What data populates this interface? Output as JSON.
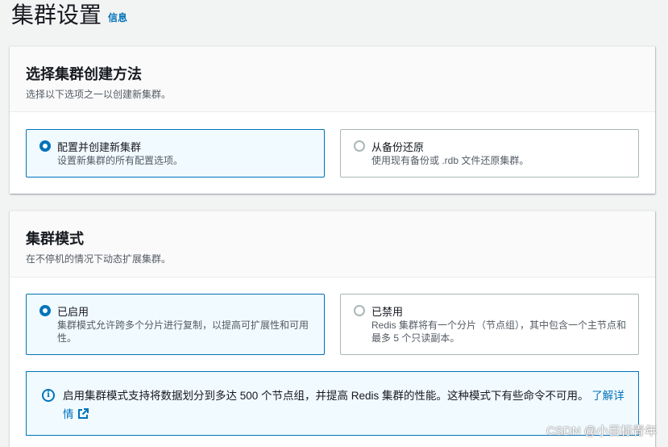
{
  "header": {
    "title": "集群设置",
    "info": "信息"
  },
  "creation_method": {
    "title": "选择集群创建方法",
    "description": "选择以下选项之一以创建新集群。",
    "options": [
      {
        "label": "配置并创建新集群",
        "description": "设置新集群的所有配置选项。",
        "selected": true
      },
      {
        "label": "从备份还原",
        "description": "使用现有备份或 .rdb 文件还原集群。",
        "selected": false
      }
    ]
  },
  "cluster_mode": {
    "title": "集群模式",
    "description": "在不停机的情况下动态扩展集群。",
    "options": [
      {
        "label": "已启用",
        "description": "集群模式允许跨多个分片进行复制，以提高可扩展性和可用性。",
        "selected": true
      },
      {
        "label": "已禁用",
        "description": "Redis 集群将有一个分片（节点组），其中包含一个主节点和最多 5 个只读副本。",
        "selected": false
      }
    ],
    "alert": {
      "text": "启用集群模式支持将数据划分到多达 500 个节点组，并提高 Redis 集群的性能。这种模式下有些命令不可用。",
      "link": "了解详情",
      "icon": "info-icon"
    }
  },
  "watermark": "CSDN @小目标青年",
  "colors": {
    "accent": "#0073bb",
    "selected_bg": "#f1faff",
    "border": "#aab7b8"
  }
}
